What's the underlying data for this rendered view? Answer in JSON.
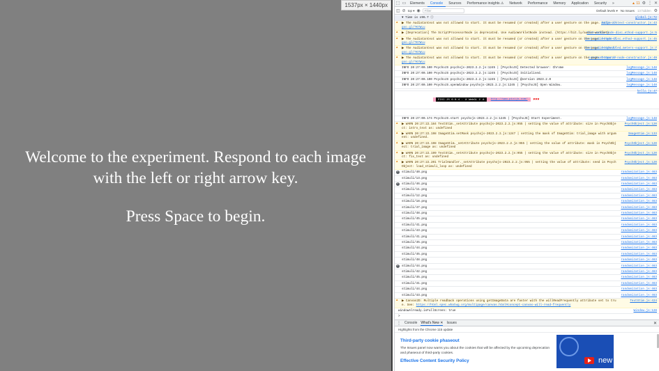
{
  "experiment": {
    "welcome_text": "Welcome to the experiment. Respond to each image with the left or right arrow key.",
    "begin_text": "Press Space to begin.",
    "dimensions": "1537px × 1440px"
  },
  "devtools": {
    "tabs": [
      "Elements",
      "Console",
      "Sources",
      "Performance insights ⚠",
      "Network",
      "Performance",
      "Memory",
      "Application",
      "Security",
      "»"
    ],
    "active_tab": "Console",
    "warning_count": "▲ 11",
    "toolbar": {
      "context": "top ▾",
      "filter_placeholder": "Filter",
      "levels": "Default levels ▾",
      "issues": "No Issues",
      "hidden": "13 hidden"
    },
    "colors": {
      "accent": "#1a73e8",
      "warning_bg": "#fffbe5",
      "warning_icon": "#e37400",
      "stage_bg": "#808080"
    },
    "logs": [
      {
        "kind": "grp",
        "text": "▼ Time is x96.7 ⓘ",
        "src": "global.js:72"
      },
      {
        "kind": "warn",
        "text": "▶ The AudioContext was not allowed to start. It must be resumed (or created) after a user gesture on the page.",
        "link": "https://goo.gl/7K7WLu",
        "src": "audio-context-constructor.js:43"
      },
      {
        "kind": "warn",
        "text": "▶ [Deprecation] The ScriptProcessorNode is deprecated. Use AudioWorkletNode instead. (https://bit.ly/audio-worklet)",
        "link": "",
        "src": "test-audio-node-disc…ethod-support.js:5"
      },
      {
        "kind": "warn",
        "text": "▶ The AudioContext was not allowed to start. It must be resumed (or created) after a user gesture on the page.",
        "link": "https://goo.gl/7K7WLu",
        "src": "test-audio-node-disc…ethod-support.js:45"
      },
      {
        "kind": "warn",
        "text": "▶ The AudioContext was not allowed to start. It must be resumed (or created) after a user gesture on the page.",
        "link": "https://goo.gl/7K7WLu",
        "src": "test-audio-scheduled…meters-support.js:7"
      },
      {
        "kind": "warn",
        "text": "▶ The AudioContext was not allowed to start. It must be resumed (or created) after a user gesture on the page.",
        "link": "https://goo.gl/7K7WLu",
        "src": "constant-source-node-constructor.js:49"
      },
      {
        "kind": "info",
        "text": "INFO 20:27:00.100 PsychoJS psychojs-2023.2.2.js:1245 | [PsychoJS] Detected browser: Chrome",
        "src": "logMessage.js:148"
      },
      {
        "kind": "info",
        "text": "INFO 20:27:00.100 PsychoJS psychojs-2023.2.2.js:1245 | [PsychoJS] Initialised.",
        "src": "logMessage.js:148"
      },
      {
        "kind": "info",
        "text": "INFO 20:27:00.100 PsychoJS psychojs-2023.2.2.js:1245 | [PsychoJS] @version 2023.2.0",
        "src": "logMessage.js:148"
      },
      {
        "kind": "info",
        "text": "INFO 20:27:00.100 PsychoJS.openWindow psychojs-2023.2.2.js:1245 | [PsychoJS] Open Window.",
        "src": "logMessage.js:148"
      },
      {
        "kind": "plain",
        "text": "",
        "src": "hello.js:47"
      }
    ],
    "banner": {
      "version": "PIXI.JS 6.0.4 - ✰ WebGL 2 ✰",
      "link": "http://www.pixijs.com/",
      "hearts": "♥♥♥"
    },
    "logs2": [
      {
        "kind": "info",
        "text": "INFO 20:27:00.174 PsychoJS.start psychojs-2023.2.2.js:1245 | [PsychoJS] Start Experiment.",
        "src": "logMessage.js:148"
      },
      {
        "kind": "warn",
        "text": "▶ WARN 20:27:22.184 TextStim._setAttribute psychojs-2023.2.2.js:955 | setting the value of attribute: size in PsychObject: intro_text as: undefined",
        "link": "",
        "src": "PsychObject.js:120"
      },
      {
        "kind": "warn",
        "text": "▶ WARN 20:27:22.198 ImageStim.setMask psychojs-2023.2.2.js:1247 | setting the mask of ImageStim: trial_image with argument: undefined.",
        "link": "",
        "src": "ImageStim.js:133"
      },
      {
        "kind": "warn",
        "text": "▶ WARN 20:27:22.198 ImageStim._setAttribute psychojs-2023.2.2.js:955 | setting the value of attribute: mask in PsychObject: trial_image as: undefined",
        "link": "",
        "src": "PsychObject.js:120"
      },
      {
        "kind": "warn",
        "text": "▶ WARN 20:27:22.199 TextStim._setAttribute psychojs-2023.2.2.js:955 | setting the value of attribute: size in PsychObject: fix_text as: undefined",
        "link": "",
        "src": "PsychObject.js:120"
      },
      {
        "kind": "warn",
        "text": "▶ WARN 20:27:22.201 TrialHandler._setAttribute psychojs-2023.2.2.js:955 | setting the value of attribute: seed in PsychObject: load_stimuli_loop as: undefined",
        "link": "",
        "src": "PsychObject.js:120"
      }
    ],
    "stim_rows": [
      {
        "count": "2",
        "name": "stimuli/40.png"
      },
      {
        "count": "",
        "name": "stimuli/13.png"
      },
      {
        "count": "2",
        "name": "stimuli/46.png"
      },
      {
        "count": "",
        "name": "stimuli/11.png"
      },
      {
        "count": "",
        "name": "stimuli/12.png"
      },
      {
        "count": "",
        "name": "stimuli/18.png"
      },
      {
        "count": "",
        "name": "stimuli/47.png"
      },
      {
        "count": "",
        "name": "stimuli/48.png"
      },
      {
        "count": "",
        "name": "stimuli/45.png"
      },
      {
        "count": "",
        "name": "stimuli/41.png"
      },
      {
        "count": "",
        "name": "stimuli/43.png"
      },
      {
        "count": "",
        "name": "stimuli/41.png"
      },
      {
        "count": "",
        "name": "stimuli/45.png"
      },
      {
        "count": "",
        "name": "stimuli/44.png"
      },
      {
        "count": "",
        "name": "stimuli/45.png"
      },
      {
        "count": "",
        "name": "stimuli/48.png"
      },
      {
        "count": "2",
        "name": "stimuli/44.png"
      },
      {
        "count": "",
        "name": "stimuli/42.png"
      },
      {
        "count": "",
        "name": "stimuli/45.png"
      },
      {
        "count": "",
        "name": "stimuli/41.png"
      },
      {
        "count": "",
        "name": "stimuli/44.png"
      },
      {
        "count": "",
        "name": "stimuli/43.png"
      }
    ],
    "stim_src": "randomization.js:463",
    "logs3": [
      {
        "kind": "warn",
        "text": "▶ Canvas2D: Multiple readback operations using getImageData are faster with the willReadFrequently attribute set to true. See:",
        "link": "https://html.spec.whatwg.org/multipage/canvas.html#concept-canvas-will-read-frequently",
        "src": "TextStim.js:424"
      },
      {
        "kind": "plain",
        "text": "windowAlready.isFullScreen: true",
        "src": "Window.js:128"
      },
      {
        "kind": "plain",
        "text": ">",
        "src": ""
      }
    ],
    "drawer": {
      "tabs": [
        "Console",
        "What's New ✕",
        "Issues"
      ],
      "subheader": "Highlights from the Chrome 115 update",
      "sections": [
        {
          "heading": "Third-party cookie phaseout",
          "body": "The Issues panel now warns you about the cookies that will be affected by the upcoming deprecation and phaseout of third-party cookies."
        },
        {
          "heading": "Effective Content Security Policy",
          "body": ""
        }
      ],
      "video_label": "new"
    }
  }
}
